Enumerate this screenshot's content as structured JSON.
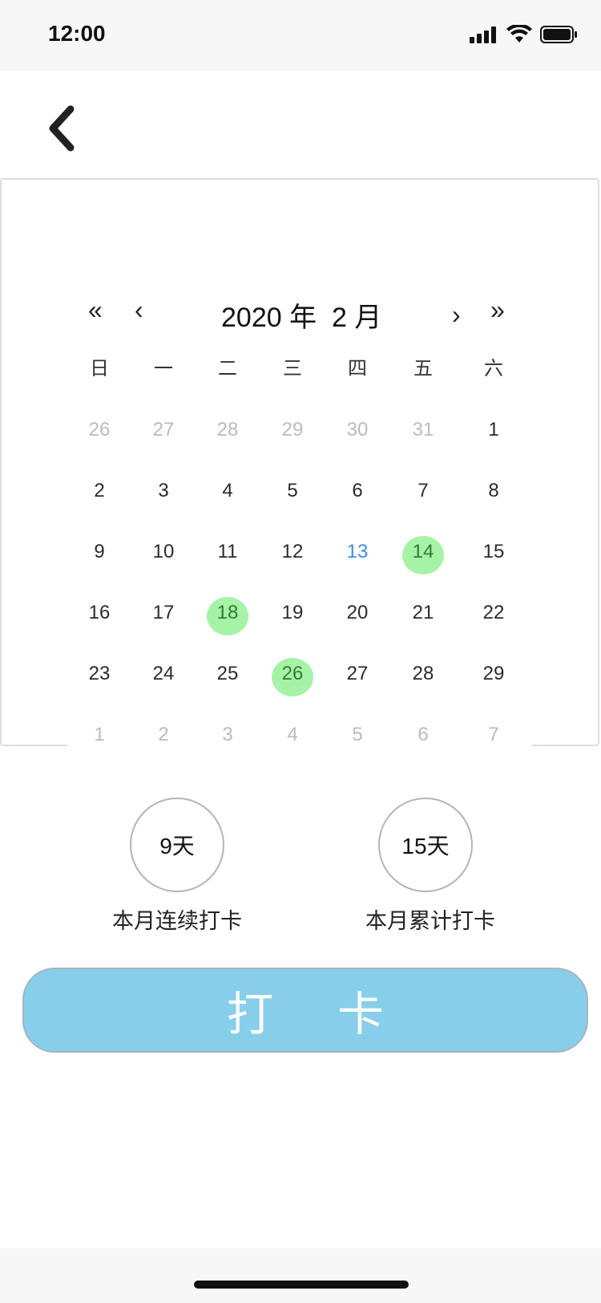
{
  "status_bar": {
    "time": "12:00",
    "icons": [
      "cellular-signal-icon",
      "wifi-icon",
      "battery-icon"
    ]
  },
  "header": {
    "back_icon": "chevron-left-icon"
  },
  "calendar": {
    "nav": {
      "prev_year": "«",
      "prev_month": "‹",
      "next_month": "›",
      "next_year": "»"
    },
    "title": "2020 年  2 月",
    "weekdays": [
      "日",
      "一",
      "二",
      "三",
      "四",
      "五",
      "六"
    ],
    "weeks": [
      [
        "26",
        "27",
        "28",
        "29",
        "30",
        "31",
        "1"
      ],
      [
        "2",
        "3",
        "4",
        "5",
        "6",
        "7",
        "8"
      ],
      [
        "9",
        "10",
        "11",
        "12",
        "13",
        "14",
        "15"
      ],
      [
        "16",
        "17",
        "18",
        "19",
        "20",
        "21",
        "22"
      ],
      [
        "23",
        "24",
        "25",
        "26",
        "27",
        "28",
        "29"
      ],
      [
        "1",
        "2",
        "3",
        "4",
        "5",
        "6",
        "7"
      ]
    ],
    "today": "13",
    "checked_in_days": [
      "14",
      "18",
      "26"
    ],
    "colors": {
      "today": "#3a8ee6",
      "checked_in_highlight": "#a6f3a8",
      "muted_day": "#b8bbc2"
    }
  },
  "stats": {
    "consecutive": {
      "value": "9天",
      "label": "本月连续打卡"
    },
    "total": {
      "value": "15天",
      "label": "本月累计打卡"
    }
  },
  "checkin_button": {
    "label": "打卡",
    "color": "#87ceeb"
  }
}
